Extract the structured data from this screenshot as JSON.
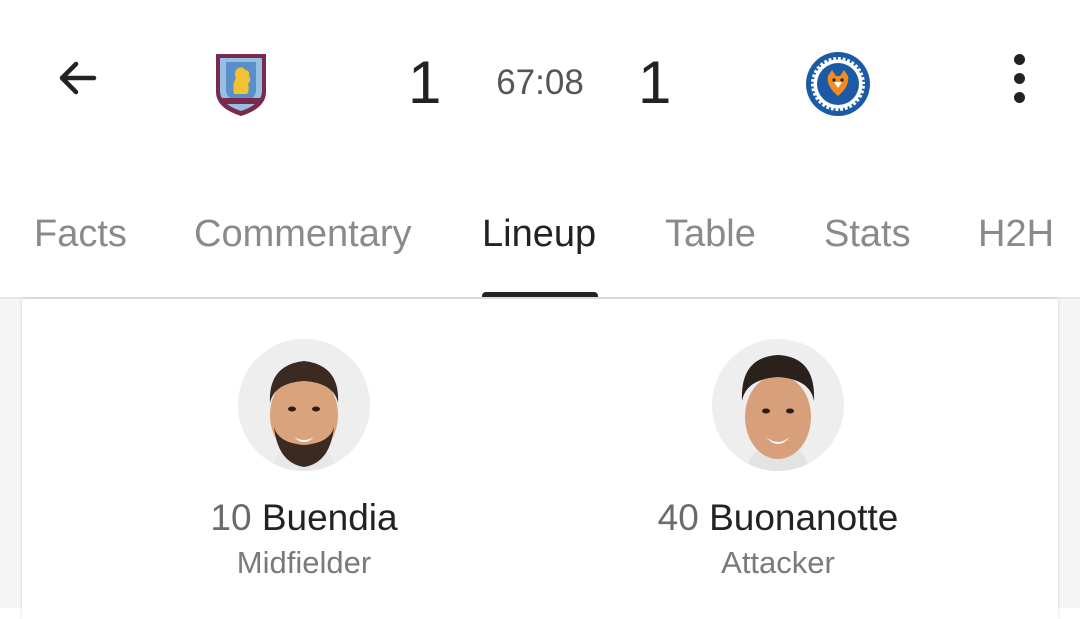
{
  "header": {
    "back_icon": "arrow-left-icon",
    "home_team_crest": "aston-villa-crest",
    "away_team_crest": "leicester-city-crest",
    "home_score": "1",
    "away_score": "1",
    "match_clock": "67:08",
    "more_icon": "more-vertical-icon"
  },
  "tabs": [
    {
      "label": "Facts"
    },
    {
      "label": "Commentary"
    },
    {
      "label": "Lineup",
      "active": true
    },
    {
      "label": "Table"
    },
    {
      "label": "Stats"
    },
    {
      "label": "H2H"
    }
  ],
  "lineup": {
    "players": [
      {
        "number": "10",
        "name": "Buendia",
        "position": "Midfielder"
      },
      {
        "number": "40",
        "name": "Buonanotte",
        "position": "Attacker"
      }
    ]
  },
  "colors": {
    "text_primary": "#222222",
    "text_muted": "#8a8a8a",
    "villa_claret": "#7a2a4a",
    "villa_blue": "#95bfe5",
    "leicester_blue": "#1c5aa6"
  }
}
